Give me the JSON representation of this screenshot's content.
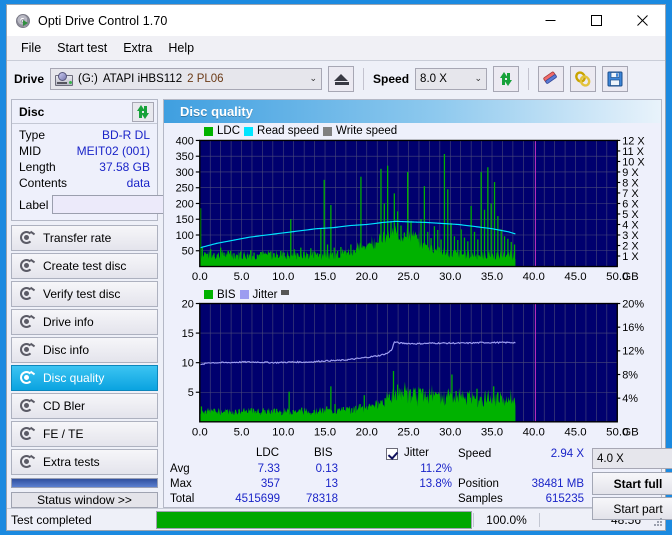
{
  "window": {
    "title": "Opti Drive Control 1.70",
    "icon": "disc-arrow-icon",
    "minimize": "−",
    "maximize": "□",
    "close": "✕"
  },
  "menu": {
    "items": [
      "File",
      "Start test",
      "Extra",
      "Help"
    ]
  },
  "toolbar": {
    "drive_label": "Drive",
    "drive_letter": "(G:)",
    "drive_model": "ATAPI iHBS112",
    "drive_firmware": "2 PL06",
    "eject_icon": "eject-icon",
    "speed_label": "Speed",
    "speed_value": "8.0 X",
    "refresh_icon": "refresh-icon",
    "eraser_icon": "eraser-icon",
    "chain_icon": "chain-icon",
    "save_icon": "save-floppy-icon"
  },
  "disc_panel": {
    "title": "Disc",
    "refresh_icon": "refresh-icon",
    "rows": [
      {
        "key": "Type",
        "value": "BD-R DL"
      },
      {
        "key": "MID",
        "value": "MEIT02 (001)"
      },
      {
        "key": "Length",
        "value": "37.58 GB"
      },
      {
        "key": "Contents",
        "value": "data"
      }
    ],
    "label_key": "Label",
    "label_value": "",
    "label_placeholder": "",
    "label_button_icon": "disc-icon"
  },
  "nav": {
    "items": [
      {
        "label": "Transfer rate",
        "icon": "disc-test-icon",
        "active": false
      },
      {
        "label": "Create test disc",
        "icon": "disc-test-icon",
        "active": false
      },
      {
        "label": "Verify test disc",
        "icon": "disc-test-icon",
        "active": false
      },
      {
        "label": "Drive info",
        "icon": "disc-test-icon",
        "active": false
      },
      {
        "label": "Disc info",
        "icon": "disc-test-icon",
        "active": false
      },
      {
        "label": "Disc quality",
        "icon": "disc-test-icon",
        "active": true
      },
      {
        "label": "CD Bler",
        "icon": "disc-test-icon",
        "active": false
      },
      {
        "label": "FE / TE",
        "icon": "disc-test-icon",
        "active": false
      },
      {
        "label": "Extra tests",
        "icon": "disc-test-icon",
        "active": false
      }
    ],
    "status_window_label": "Status window >>"
  },
  "panel": {
    "title": "Disc quality",
    "icon": "disc-test-icon"
  },
  "stats": {
    "col_headers": [
      "LDC",
      "BIS"
    ],
    "row_labels": [
      "Avg",
      "Max",
      "Total"
    ],
    "ldc": {
      "avg": "7.33",
      "max": "357",
      "total": "4515699"
    },
    "bis": {
      "avg": "0.13",
      "max": "13",
      "total": "78318"
    },
    "jitter_label": "Jitter",
    "jitter_checked": true,
    "jitter_avg": "11.2%",
    "jitter_max": "13.8%",
    "speed_key": "Speed",
    "speed_value": "2.94 X",
    "position_key": "Position",
    "position_value": "38481 MB",
    "samples_key": "Samples",
    "samples_value": "615235",
    "test_speed_value": "4.0 X",
    "start_full_label": "Start full",
    "start_part_label": "Start part"
  },
  "statusbar": {
    "message": "Test completed",
    "progress_percent": "100.0%",
    "progress_value": 100,
    "elapsed": "48:56"
  },
  "colors": {
    "ldc_green": "#00b200",
    "bis_green": "#00b200",
    "read_speed_cyan": "#00e5ff",
    "write_speed_gray": "#808080",
    "jitter_lilac": "#9c9cf0",
    "plot_bg": "#00006e",
    "grid": "#4a4a7a",
    "marker_magenta": "#c030c0",
    "accent_blue": "#1a24c8",
    "progress_green": "#00a800"
  },
  "chart_data": [
    {
      "type": "area",
      "title": "Disc quality - LDC",
      "xlabel": "GB",
      "ylabel": "LDC",
      "xlim": [
        0,
        50
      ],
      "ylim": [
        0,
        400
      ],
      "xticks": [
        "0.0",
        "5.0",
        "10.0",
        "15.0",
        "20.0",
        "25.0",
        "30.0",
        "35.0",
        "40.0",
        "45.0",
        "50.0"
      ],
      "yticks": [
        50,
        100,
        150,
        200,
        250,
        300,
        350,
        400
      ],
      "y2label": "Speed",
      "y2lim": [
        0,
        12
      ],
      "y2ticks": [
        "1 X",
        "2 X",
        "3 X",
        "4 X",
        "5 X",
        "6 X",
        "7 X",
        "8 X",
        "9 X",
        "10 X",
        "11 X",
        "12 X"
      ],
      "grid": true,
      "legend": [
        {
          "name": "LDC",
          "color": "#00b200"
        },
        {
          "name": "Read speed",
          "color": "#00e5ff"
        },
        {
          "name": "Write speed",
          "color": "#808080"
        }
      ],
      "data_end_gb": 37.8,
      "marker_gb": 40.2,
      "series": [
        {
          "name": "LDC",
          "color": "#00b200",
          "type": "spike-area",
          "x": [
            0.1,
            0.3,
            0.6,
            0.9,
            1.3,
            1.7,
            2.1,
            2.5,
            2.9,
            3.3,
            3.7,
            4.1,
            4.5,
            4.9,
            5.3,
            5.7,
            6.1,
            6.5,
            6.9,
            7.3,
            7.7,
            8.1,
            8.5,
            8.9,
            9.3,
            9.7,
            10.1,
            10.5,
            10.9,
            11.3,
            11.7,
            12.1,
            12.5,
            12.9,
            13.3,
            13.7,
            14.1,
            14.5,
            14.9,
            15.3,
            15.7,
            16.1,
            16.5,
            16.9,
            17.3,
            17.7,
            18.1,
            18.5,
            18.9,
            19.3,
            19.7,
            20.1,
            20.5,
            20.9,
            21.3,
            21.7,
            22.1,
            22.5,
            22.9,
            23.3,
            23.7,
            24.1,
            24.5,
            24.9,
            25.3,
            25.7,
            26.1,
            26.5,
            26.9,
            27.3,
            27.7,
            28.1,
            28.5,
            28.9,
            29.3,
            29.7,
            30.1,
            30.5,
            30.9,
            31.3,
            31.7,
            32.1,
            32.5,
            32.9,
            33.3,
            33.7,
            34.1,
            34.5,
            34.9,
            35.3,
            35.7,
            36.1,
            36.5,
            36.9,
            37.3,
            37.7
          ],
          "y": [
            185,
            60,
            45,
            40,
            55,
            42,
            38,
            60,
            44,
            38,
            50,
            42,
            36,
            48,
            40,
            38,
            52,
            44,
            38,
            46,
            40,
            36,
            48,
            42,
            38,
            50,
            44,
            38,
            150,
            55,
            42,
            60,
            46,
            40,
            58,
            48,
            42,
            120,
            275,
            70,
            195,
            60,
            50,
            62,
            48,
            44,
            70,
            52,
            46,
            285,
            64,
            50,
            72,
            58,
            50,
            310,
            200,
            320,
            145,
            232,
            175,
            130,
            108,
            300,
            145,
            96,
            88,
            150,
            255,
            110,
            90,
            128,
            116,
            86,
            357,
            245,
            138,
            96,
            84,
            118,
            92,
            80,
            192,
            110,
            86,
            300,
            180,
            315,
            200,
            268,
            160,
            118,
            96,
            88,
            78,
            70
          ],
          "baseline_band": "dense low-level noise 20-60 across 0-37.8 GB, rising to 60-140 in the 22-26 GB region"
        },
        {
          "name": "Read speed",
          "color": "#00e5ff",
          "type": "line",
          "axis": "y2",
          "x": [
            0.1,
            2,
            4,
            6,
            8,
            10,
            12,
            14,
            16,
            18,
            20,
            22,
            23.5,
            25,
            27,
            29,
            31,
            33,
            35,
            37,
            37.8
          ],
          "y_speed_x": [
            1.8,
            2.2,
            2.5,
            2.8,
            3.0,
            3.2,
            3.4,
            3.6,
            3.7,
            3.9,
            4.0,
            4.2,
            4.3,
            4.25,
            4.2,
            4.1,
            4.0,
            3.8,
            3.6,
            3.3,
            3.1
          ]
        },
        {
          "name": "Write speed",
          "color": "#808080",
          "type": "line",
          "x": [],
          "y": []
        }
      ]
    },
    {
      "type": "area",
      "title": "Disc quality - BIS / Jitter",
      "xlabel": "GB",
      "ylabel": "BIS",
      "xlim": [
        0,
        50
      ],
      "ylim": [
        0,
        20
      ],
      "xticks": [
        "0.0",
        "5.0",
        "10.0",
        "15.0",
        "20.0",
        "25.0",
        "30.0",
        "35.0",
        "40.0",
        "45.0",
        "50.0"
      ],
      "yticks": [
        5,
        10,
        15,
        20
      ],
      "y2label": "Jitter",
      "y2lim": [
        0,
        20
      ],
      "y2ticks": [
        "4%",
        "8%",
        "12%",
        "16%",
        "20%"
      ],
      "grid": true,
      "legend": [
        {
          "name": "BIS",
          "color": "#00b200"
        },
        {
          "name": "Jitter",
          "color": "#9c9cf0"
        },
        {
          "name": "",
          "color": "#555555"
        }
      ],
      "data_end_gb": 37.8,
      "marker_gb": 40.2,
      "series": [
        {
          "name": "BIS",
          "color": "#00b200",
          "type": "spike-area",
          "x": [
            0.2,
            0.7,
            1.2,
            1.7,
            2.2,
            2.7,
            3.2,
            3.7,
            4.2,
            4.7,
            5.2,
            5.7,
            6.2,
            6.7,
            7.2,
            7.7,
            8.2,
            8.7,
            9.2,
            9.7,
            10.2,
            10.7,
            11.2,
            11.7,
            12.2,
            12.7,
            13.2,
            13.7,
            14.2,
            14.7,
            15.2,
            15.7,
            16.2,
            16.7,
            17.2,
            17.7,
            18.2,
            18.7,
            19.2,
            19.7,
            20.2,
            20.7,
            21.2,
            21.7,
            22.2,
            22.7,
            23.2,
            23.7,
            24.2,
            24.7,
            25.2,
            25.7,
            26.2,
            26.7,
            27.2,
            27.7,
            28.2,
            28.7,
            29.2,
            29.7,
            30.2,
            30.7,
            31.2,
            31.7,
            32.2,
            32.7,
            33.2,
            33.7,
            34.2,
            34.7,
            35.2,
            35.7,
            36.2,
            36.7,
            37.2,
            37.7
          ],
          "y": [
            2.6,
            1.9,
            1.6,
            2.2,
            1.7,
            1.5,
            2.0,
            1.6,
            1.4,
            2.1,
            1.7,
            1.5,
            2.3,
            1.8,
            1.5,
            2.0,
            1.6,
            1.4,
            2.2,
            1.7,
            1.5,
            5.1,
            2.0,
            1.6,
            2.4,
            1.8,
            1.5,
            2.0,
            1.7,
            2.2,
            2.6,
            6.0,
            3.0,
            2.2,
            2.5,
            2.0,
            2.3,
            2.7,
            3.0,
            4.5,
            2.6,
            2.9,
            3.3,
            3.6,
            4.0,
            4.6,
            8.6,
            6.3,
            5.0,
            4.4,
            5.5,
            4.0,
            3.6,
            5.6,
            4.2,
            3.0,
            3.4,
            4.3,
            3.0,
            3.8,
            8.0,
            5.2,
            3.4,
            2.8,
            3.2,
            2.6,
            5.6,
            4.2,
            3.0,
            3.4,
            6.0,
            5.0,
            3.2,
            2.6,
            2.2,
            2.0
          ],
          "baseline_band": "dense low-level noise 1.2-2.5 across 0-22 GB, elevated 2.5-5 from 22-37.8 GB"
        },
        {
          "name": "Jitter",
          "color": "#9c9cf0",
          "type": "line",
          "axis": "y2",
          "x": [
            0.1,
            1,
            3,
            5,
            7,
            9,
            11,
            13,
            15,
            17,
            19,
            20.5,
            21.5,
            22.5,
            23.0,
            23.3,
            24,
            26,
            28,
            30,
            32,
            34,
            36,
            37.8
          ],
          "y_percent": [
            9.6,
            10.0,
            10.0,
            10.1,
            10.1,
            10.0,
            10.1,
            10.1,
            10.3,
            10.4,
            10.7,
            11.0,
            11.2,
            11.6,
            12.2,
            13.5,
            13.3,
            13.2,
            13.3,
            13.3,
            13.3,
            13.4,
            13.4,
            13.4
          ]
        }
      ]
    }
  ]
}
